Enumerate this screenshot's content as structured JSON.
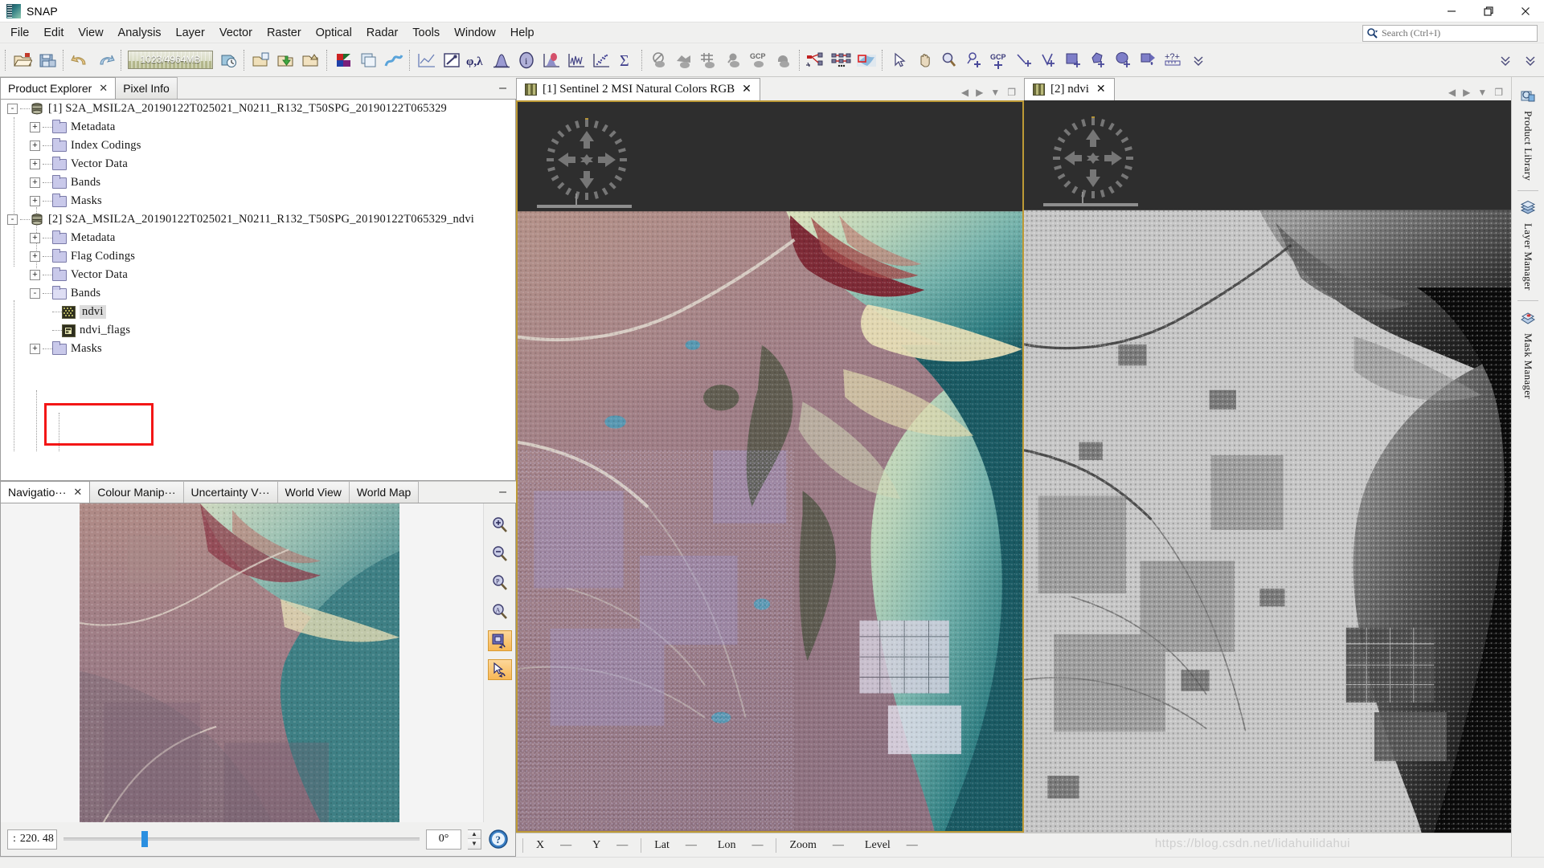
{
  "window": {
    "title": "SNAP",
    "icon": "snap-logo-icon",
    "minimize": "–",
    "maximize": "❐",
    "close": "✕"
  },
  "menubar": {
    "items": [
      {
        "label": "File"
      },
      {
        "label": "Edit"
      },
      {
        "label": "View"
      },
      {
        "label": "Analysis"
      },
      {
        "label": "Layer"
      },
      {
        "label": "Vector"
      },
      {
        "label": "Raster"
      },
      {
        "label": "Optical"
      },
      {
        "label": "Radar"
      },
      {
        "label": "Tools"
      },
      {
        "label": "Window"
      },
      {
        "label": "Help"
      }
    ]
  },
  "search": {
    "placeholder": "Search (Ctrl+I)",
    "icon": "search-icon"
  },
  "toolbar": {
    "memory_label": "1023/4964MB",
    "memory_used_mb": 1023,
    "memory_total_mb": 4964,
    "buttons": [
      {
        "name": "open-product-icon"
      },
      {
        "name": "save-product-icon"
      },
      {
        "name": "undo-icon"
      },
      {
        "name": "redo-icon"
      },
      {
        "name": "reopen-product-icon"
      },
      {
        "name": "new-subset-icon"
      },
      {
        "name": "import-product-icon"
      },
      {
        "name": "export-product-icon"
      },
      {
        "name": "rgb-image-view-icon"
      },
      {
        "name": "open-image-view-icon"
      },
      {
        "name": "bandmaths-icon"
      },
      {
        "name": "profile-plot-icon"
      },
      {
        "name": "colour-manipulation-icon"
      },
      {
        "name": "geo-coding-icon"
      },
      {
        "name": "histogram-icon"
      },
      {
        "name": "information-icon"
      },
      {
        "name": "density-plot-icon"
      },
      {
        "name": "correlative-plot-icon"
      },
      {
        "name": "scatter-plot-icon"
      },
      {
        "name": "statistics-icon"
      },
      {
        "name": "no-data-overlay-icon"
      },
      {
        "name": "geometry-overlay-icon"
      },
      {
        "name": "graticule-overlay-icon"
      },
      {
        "name": "pin-overlay-icon"
      },
      {
        "name": "gcp-overlay-icon"
      },
      {
        "name": "mask-overlay-icon"
      },
      {
        "name": "graph-builder-icon"
      },
      {
        "name": "batch-processing-icon"
      },
      {
        "name": "subset-region-icon"
      },
      {
        "name": "select-tool-icon"
      },
      {
        "name": "pan-tool-icon"
      },
      {
        "name": "zoom-tool-icon"
      },
      {
        "name": "pin-placing-tool-icon"
      },
      {
        "name": "gcp-placing-tool-icon"
      },
      {
        "name": "line-drawing-tool-icon"
      },
      {
        "name": "polyline-drawing-tool-icon"
      },
      {
        "name": "rectangle-drawing-tool-icon"
      },
      {
        "name": "polygon-drawing-tool-icon"
      },
      {
        "name": "ellipse-drawing-tool-icon"
      },
      {
        "name": "magic-wand-tool-icon"
      },
      {
        "name": "range-finder-tool-icon"
      },
      {
        "name": "toolbar-overflow-icon"
      }
    ]
  },
  "explorer": {
    "tabs": [
      {
        "label": "Product Explorer",
        "active": true,
        "closable": true
      },
      {
        "label": "Pixel Info",
        "active": false,
        "closable": false
      }
    ],
    "minimize_glyph": "–",
    "tree": [
      {
        "level": 0,
        "icon": "product-icon",
        "label": "[1] S2A_MSIL2A_20190122T025021_N0211_R132_T50SPG_20190122T065329",
        "expander": "-"
      },
      {
        "level": 1,
        "icon": "folder-icon",
        "label": "Metadata",
        "expander": "+"
      },
      {
        "level": 1,
        "icon": "folder-icon",
        "label": "Index Codings",
        "expander": "+"
      },
      {
        "level": 1,
        "icon": "folder-icon",
        "label": "Vector Data",
        "expander": "+"
      },
      {
        "level": 1,
        "icon": "folder-icon",
        "label": "Bands",
        "expander": "+"
      },
      {
        "level": 1,
        "icon": "folder-icon",
        "label": "Masks",
        "expander": "+"
      },
      {
        "level": 0,
        "icon": "product-icon",
        "label": "[2] S2A_MSIL2A_20190122T025021_N0211_R132_T50SPG_20190122T065329_ndvi",
        "expander": "-"
      },
      {
        "level": 1,
        "icon": "folder-icon",
        "label": "Metadata",
        "expander": "+"
      },
      {
        "level": 1,
        "icon": "folder-icon",
        "label": "Flag Codings",
        "expander": "+"
      },
      {
        "level": 1,
        "icon": "folder-icon",
        "label": "Vector Data",
        "expander": "+"
      },
      {
        "level": 1,
        "icon": "folder-open-icon",
        "label": "Bands",
        "expander": "-"
      },
      {
        "level": 2,
        "icon": "band-icon",
        "label": "ndvi",
        "expander": "",
        "selected": true
      },
      {
        "level": 2,
        "icon": "flag-band-icon",
        "label": "ndvi_flags",
        "expander": ""
      },
      {
        "level": 1,
        "icon": "folder-icon",
        "label": "Masks",
        "expander": "+"
      }
    ],
    "highlight_color": "#f31616"
  },
  "bottom_panel": {
    "tabs": [
      {
        "label": "Navigatio···",
        "active": true,
        "closable": true
      },
      {
        "label": "Colour Manip···",
        "active": false,
        "closable": false
      },
      {
        "label": "Uncertainty V···",
        "active": false,
        "closable": false
      },
      {
        "label": "World View",
        "active": false,
        "closable": false
      },
      {
        "label": "World Map",
        "active": false,
        "closable": false
      }
    ],
    "minimize_glyph": "–",
    "tools": [
      {
        "name": "zoom-in-icon",
        "active": false
      },
      {
        "name": "zoom-out-icon",
        "active": false
      },
      {
        "name": "zoom-to-pixel-resolution-icon",
        "active": false
      },
      {
        "name": "zoom-all-icon",
        "active": false
      },
      {
        "name": "sync-views-icon",
        "active": true
      },
      {
        "name": "sync-cursors-icon",
        "active": true
      }
    ],
    "zoom_value": "220. 48",
    "zoom_prefix": ":",
    "rotation_value": "0°",
    "slider_percent": 22,
    "help_icon": "help-icon"
  },
  "views": {
    "left": {
      "tab_label": "[1] Sentinel 2 MSI Natural Colors RGB",
      "tab_close": "✕",
      "tab_icon": "band-thumbnail-icon",
      "controls": [
        "previous-view-icon",
        "next-view-icon",
        "view-list-dropdown-icon",
        "maximize-view-icon"
      ],
      "border_color": "#bd9a36",
      "background_color": "#2e2e2e",
      "compass_icon": "navigation-compass-icon",
      "scalebar": "scale-bar"
    },
    "right": {
      "tab_label": "[2] ndvi",
      "tab_close": "✕",
      "tab_icon": "band-thumbnail-icon",
      "controls": [
        "previous-view-icon",
        "next-view-icon",
        "view-list-dropdown-icon",
        "maximize-view-icon"
      ],
      "background_color": "#2e2e2e",
      "compass_icon": "navigation-compass-icon",
      "scalebar": "scale-bar"
    }
  },
  "rail": {
    "items": [
      {
        "label": "Product Library",
        "icon": "product-library-icon"
      },
      {
        "label": "Layer Manager",
        "icon": "layer-manager-icon"
      },
      {
        "label": "Mask Manager",
        "icon": "mask-manager-icon"
      }
    ]
  },
  "statusbar": {
    "fields": [
      {
        "label": "X",
        "value": "—"
      },
      {
        "label": "Y",
        "value": "—"
      },
      {
        "label": "Lat",
        "value": "—"
      },
      {
        "label": "Lon",
        "value": "—"
      },
      {
        "label": "Zoom",
        "value": "—"
      },
      {
        "label": "Level",
        "value": "—"
      }
    ],
    "watermark": "https://blog.csdn.net/lidahuilidahui"
  }
}
